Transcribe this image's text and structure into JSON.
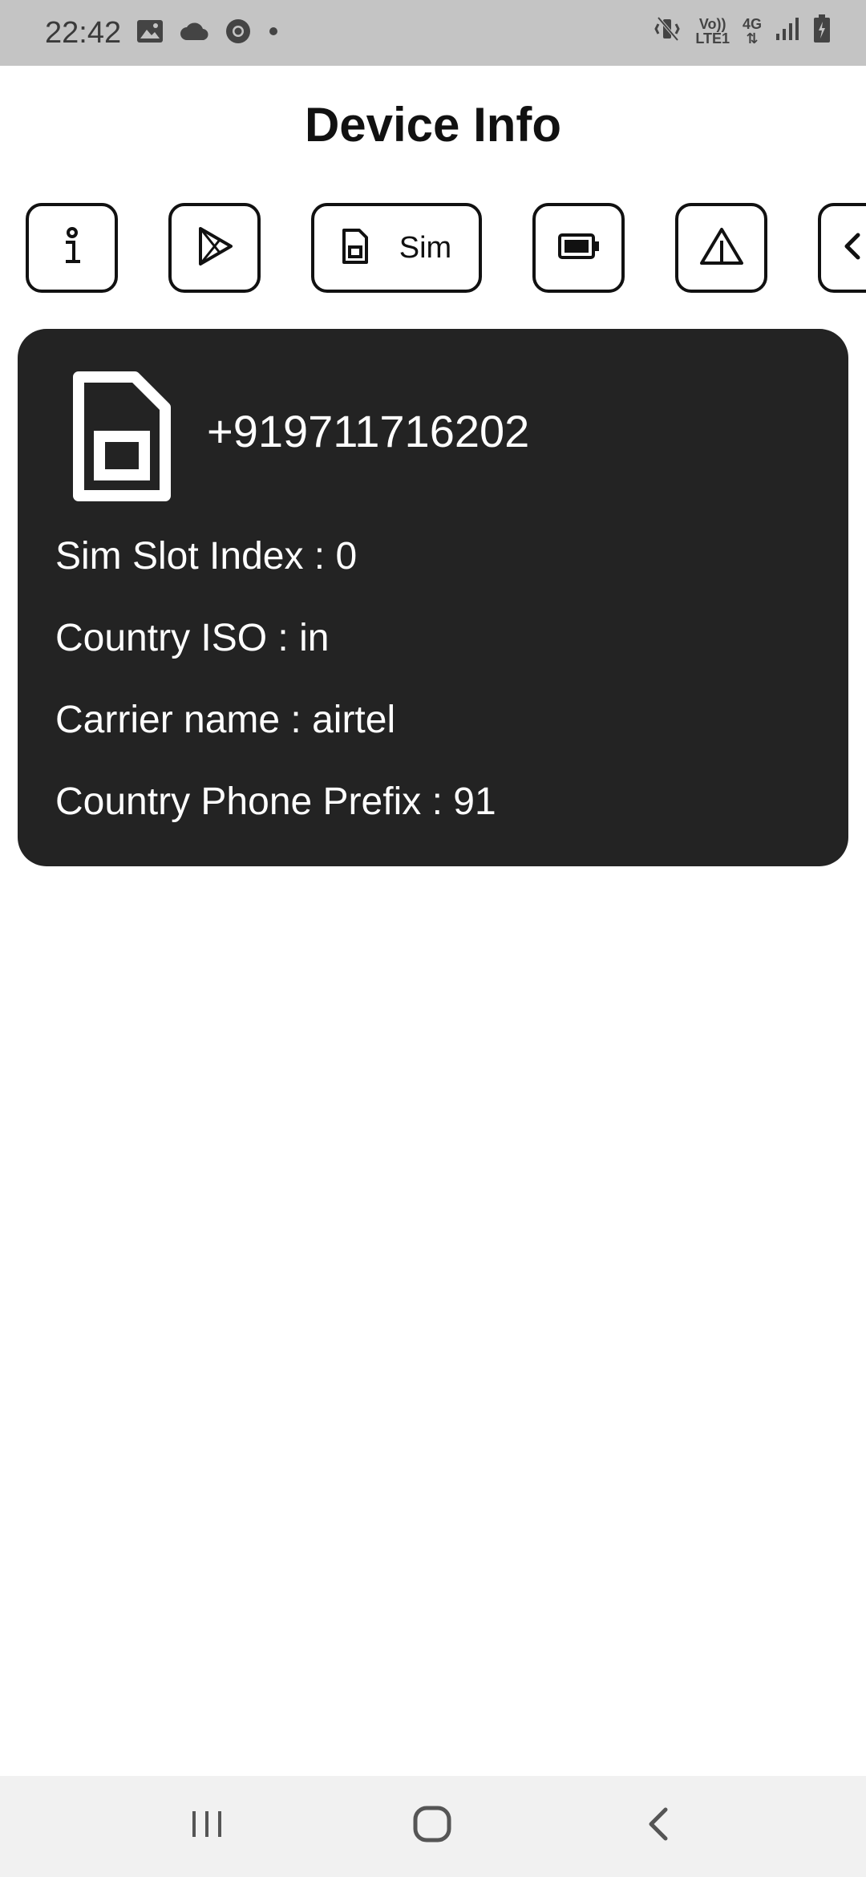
{
  "status_bar": {
    "time": "22:42",
    "left_icons": [
      "image-icon",
      "cloud-icon",
      "chrome-icon",
      "dot-icon"
    ],
    "right_icons": [
      "vibrate-mute-icon",
      "volte-icon",
      "4g-icon",
      "signal-icon",
      "battery-icon"
    ],
    "volte_top": "Vo))",
    "volte_bottom": "LTE1",
    "network_type": "4G"
  },
  "header": {
    "title": "Device Info"
  },
  "tabs": [
    {
      "icon": "info-icon",
      "label": ""
    },
    {
      "icon": "play-store-icon",
      "label": ""
    },
    {
      "icon": "sim-card-icon",
      "label": "Sim",
      "selected": true
    },
    {
      "icon": "battery-icon",
      "label": ""
    },
    {
      "icon": "warning-icon",
      "label": ""
    },
    {
      "icon": "chevron-left-icon",
      "label": ""
    }
  ],
  "sim_card": {
    "phone_number": "+919711716202",
    "rows": [
      "Sim Slot Index : 0",
      "Country ISO : in",
      "Carrier name : airtel",
      "Country Phone Prefix : 91"
    ]
  },
  "nav_bar": {
    "buttons": [
      "recent-apps-icon",
      "home-icon",
      "back-icon"
    ]
  },
  "colors": {
    "status_bar_bg": "#c4c4c4",
    "card_bg": "#232323",
    "nav_bar_bg": "#f1f1f1",
    "accent": "#111111"
  }
}
